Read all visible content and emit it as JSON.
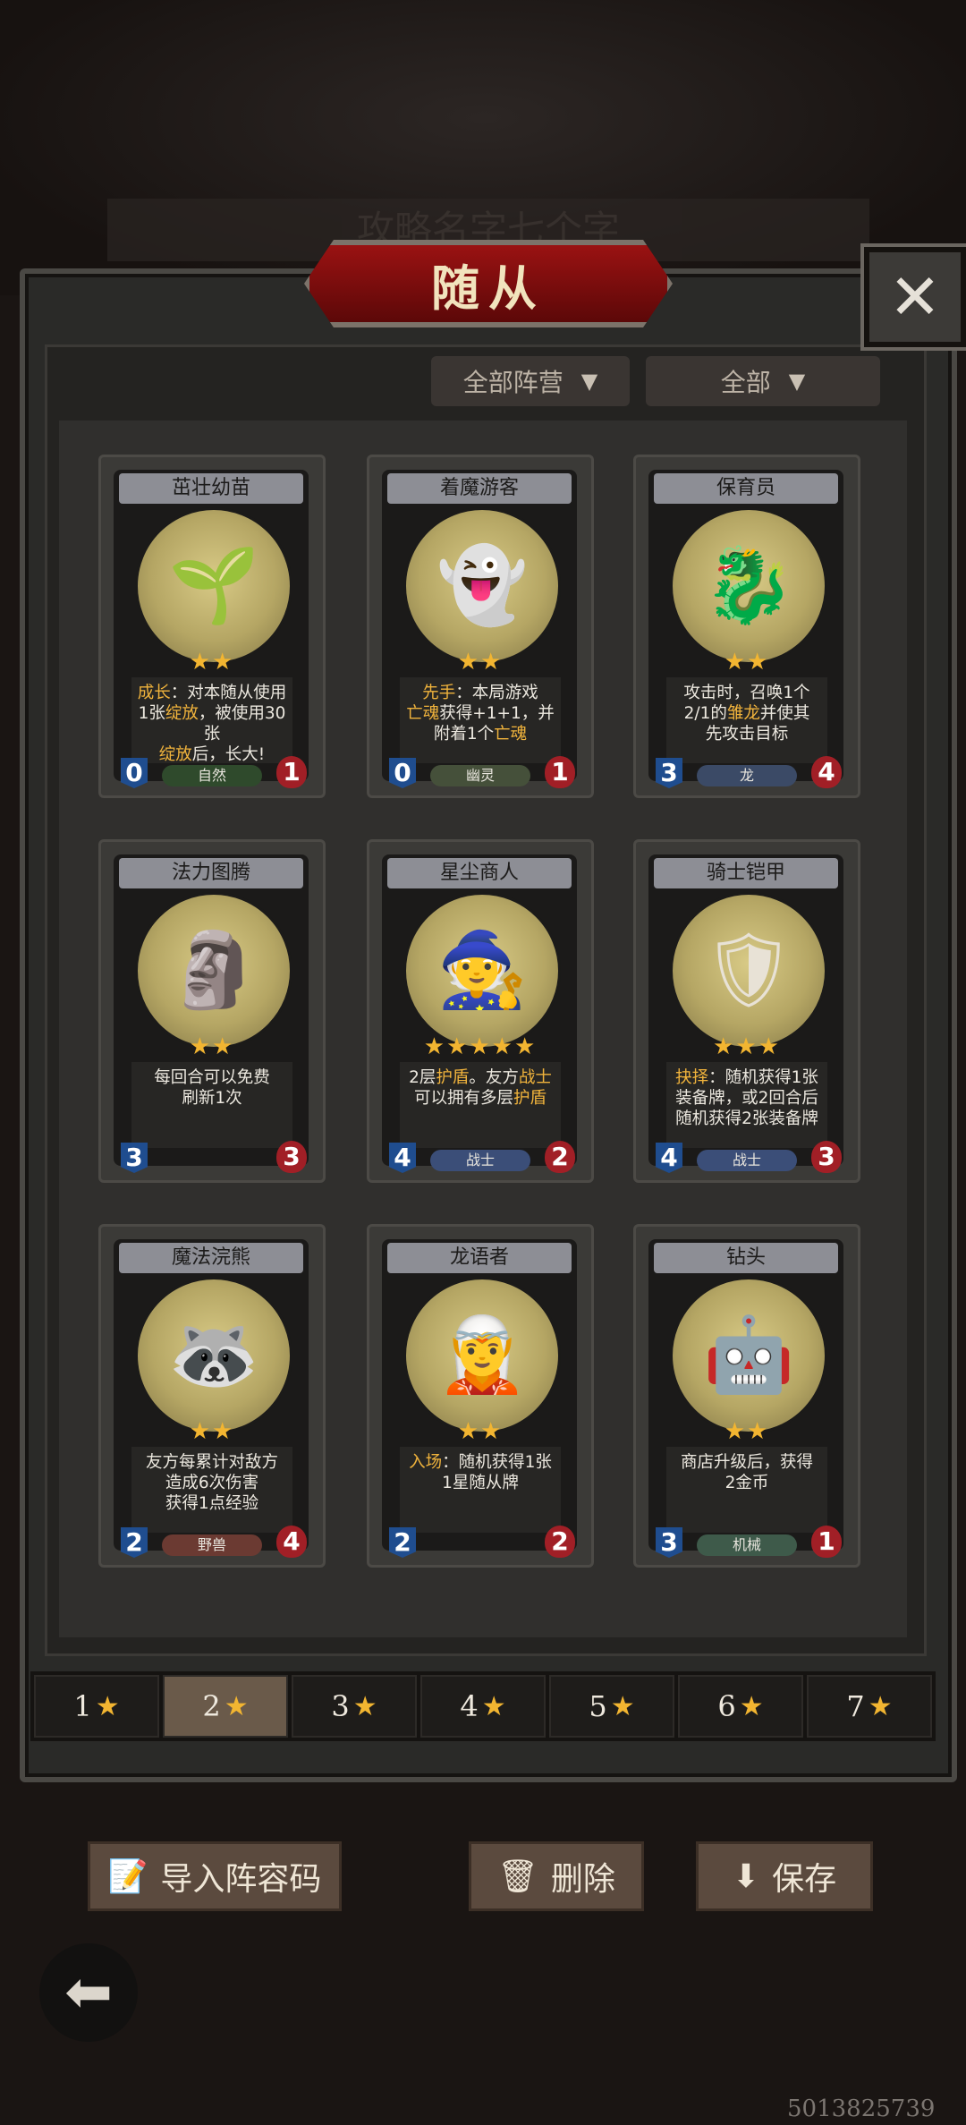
{
  "background_title": "攻略名字七个字",
  "title": "随从",
  "filters": {
    "faction": "全部阵营",
    "type": "全部"
  },
  "cards": [
    {
      "name": "茁壮幼苗",
      "icon": "sprout-icon",
      "emoji": "🌱",
      "stars": "★★",
      "desc": [
        "成长：对本随从使用",
        "1张绽放，被使用30张",
        "绽放后，长大!"
      ],
      "attack": "0",
      "health": "1",
      "tribe": "自然",
      "tribe_color": "#2f4a2c"
    },
    {
      "name": "着魔游客",
      "icon": "haunted-tourist-icon",
      "emoji": "👻",
      "stars": "★★",
      "desc": [
        "先手：本局游戏",
        "亡魂获得+1+1，并",
        "附着1个亡魂"
      ],
      "attack": "0",
      "health": "1",
      "tribe": "幽灵",
      "tribe_color": "#45503a"
    },
    {
      "name": "保育员",
      "icon": "caretaker-icon",
      "emoji": "🐉",
      "stars": "★★",
      "desc": [
        "攻击时，召唤1个",
        "2/1的雏龙并使其",
        "先攻击目标"
      ],
      "attack": "3",
      "health": "4",
      "tribe": "龙",
      "tribe_color": "#3b4a66"
    },
    {
      "name": "法力图腾",
      "icon": "mana-totem-icon",
      "emoji": "🗿",
      "stars": "★★",
      "desc": [
        "每回合可以免费",
        "刷新1次"
      ],
      "attack": "3",
      "health": "3",
      "tribe": "",
      "tribe_color": "#272624"
    },
    {
      "name": "星尘商人",
      "icon": "stardust-merchant-icon",
      "emoji": "🧙",
      "stars": "★★★★★",
      "desc": [
        "2层护盾。友方战士",
        "可以拥有多层护盾"
      ],
      "attack": "4",
      "health": "2",
      "tribe": "战士",
      "tribe_color": "#3b4e78"
    },
    {
      "name": "骑士铠甲",
      "icon": "knight-armor-icon",
      "emoji": "🛡",
      "stars": "★★★",
      "desc": [
        "抉择：随机获得1张",
        "装备牌，或2回合后",
        "随机获得2张装备牌"
      ],
      "attack": "4",
      "health": "3",
      "tribe": "战士",
      "tribe_color": "#3b4e78"
    },
    {
      "name": "魔法浣熊",
      "icon": "magic-raccoon-icon",
      "emoji": "🦝",
      "stars": "★★",
      "desc": [
        "友方每累计对敌方",
        "造成6次伤害",
        "获得1点经验"
      ],
      "attack": "2",
      "health": "4",
      "tribe": "野兽",
      "tribe_color": "#6b3a32"
    },
    {
      "name": "龙语者",
      "icon": "dragon-speaker-icon",
      "emoji": "🧝",
      "stars": "★★",
      "desc": [
        "入场：随机获得1张",
        "1星随从牌"
      ],
      "attack": "2",
      "health": "2",
      "tribe": "",
      "tribe_color": "#272624"
    },
    {
      "name": "钻头",
      "icon": "drill-robot-icon",
      "emoji": "🤖",
      "stars": "★★",
      "desc": [
        "商店升级后，获得",
        "2金币"
      ],
      "attack": "3",
      "health": "1",
      "tribe": "机械",
      "tribe_color": "#3e5a4a"
    }
  ],
  "tier_tabs": [
    "1",
    "2",
    "3",
    "4",
    "5",
    "6",
    "7"
  ],
  "active_tier": "2",
  "actions": {
    "import": "导入阵容码",
    "delete": "删除",
    "save": "保存"
  },
  "watermark": "5013825739"
}
